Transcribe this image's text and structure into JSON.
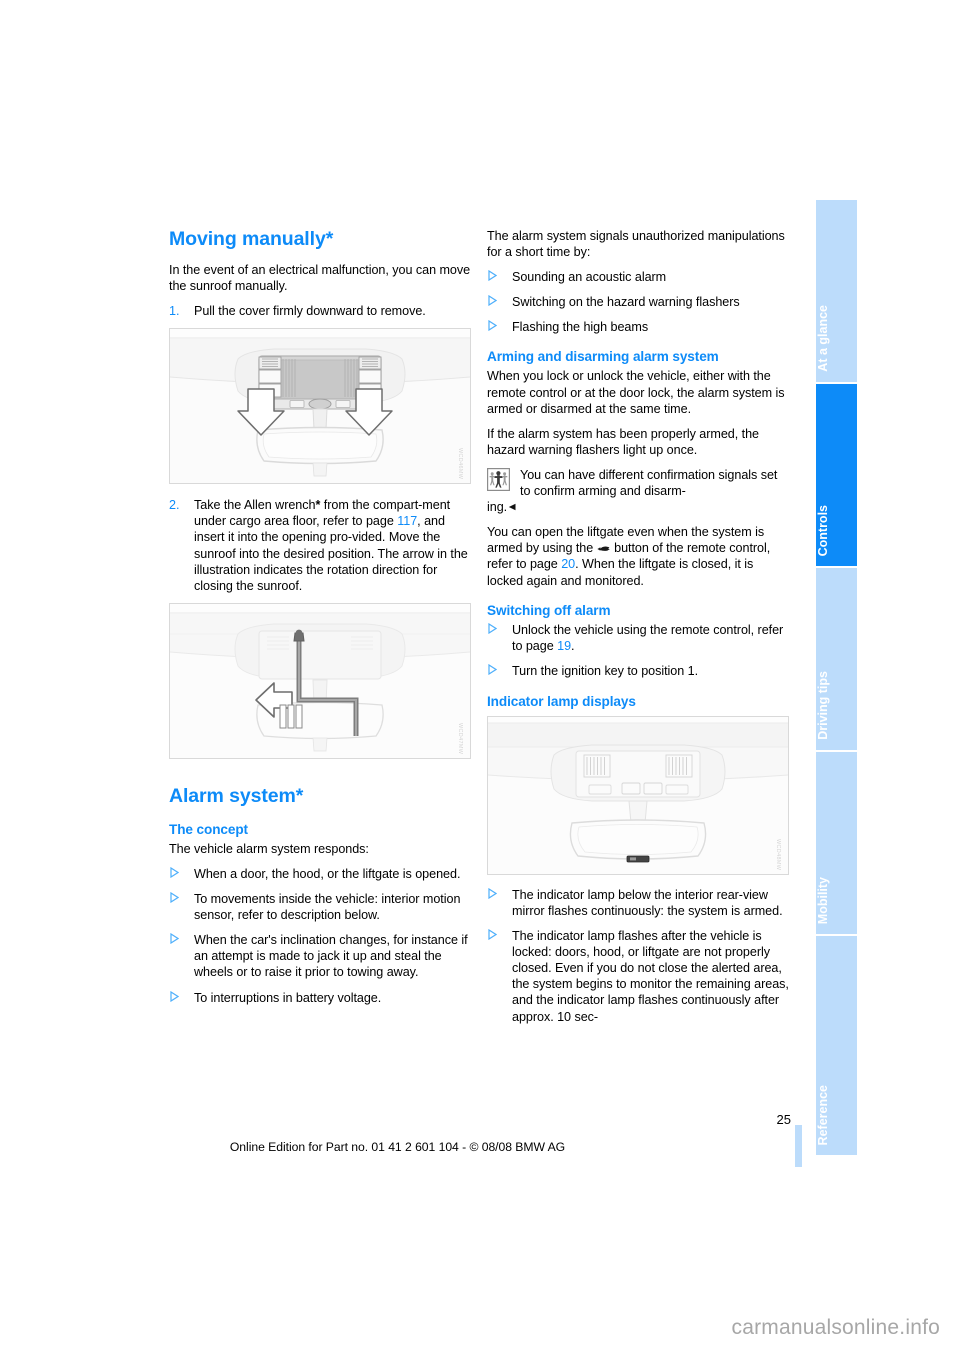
{
  "document": {
    "page_number": "25",
    "edition_line": "Online Edition for Part no. 01 41 2 601 104 - © 08/08 BMW AG",
    "site_watermark": "carmanualsonline.info"
  },
  "colors": {
    "accent_blue": "#0d8bf8",
    "tab_inactive": "#bcdcfb",
    "bullet_blue": "#4eaffb"
  },
  "tab_rail": {
    "tabs": [
      {
        "label": "At a glance",
        "active": false
      },
      {
        "label": "Controls",
        "active": true
      },
      {
        "label": "Driving tips",
        "active": false
      },
      {
        "label": "Mobility",
        "active": false
      },
      {
        "label": "Reference",
        "active": false
      }
    ]
  },
  "left_column": {
    "heading_moving_manually": "Moving manually*",
    "intro": "In the event of an electrical malfunction, you can move the sunroof manually.",
    "step1_num": "1.",
    "step1_text": "Pull the cover firmly downward to remove.",
    "figure1": {
      "code": "WCD46MW"
    },
    "step2_num": "2.",
    "step2_part1": "Take the Allen wrench",
    "step2_star": "*",
    "step2_part2": " from the compart-ment under cargo area floor, refer to page ",
    "step2_pageref": "117",
    "step2_part3": ", and insert it into the opening pro-vided. Move the sunroof into the desired position. The arrow in the illustration indicates the rotation direction for closing the sunroof.",
    "figure2": {
      "code": "WCD47MW"
    },
    "heading_alarm_system": "Alarm system*",
    "heading_concept": "The concept",
    "concept_intro": "The vehicle alarm system responds:",
    "concept_bullets": [
      "When a door, the hood, or the liftgate is opened.",
      "To movements inside the vehicle: interior motion sensor, refer to description below.",
      "When the car's inclination changes, for instance if an attempt is made to jack it up and steal the wheels or to raise it prior to towing away.",
      "To interruptions in battery voltage."
    ]
  },
  "right_column": {
    "signals_intro": "The alarm system signals unauthorized manipulations for a short time by:",
    "signal_bullets": [
      "Sounding an acoustic alarm",
      "Switching on the hazard warning flashers",
      "Flashing the high beams"
    ],
    "heading_arming": "Arming and disarming alarm system",
    "arming_p1": "When you lock or unlock the vehicle, either with the remote control or at the door lock, the alarm system is armed or disarmed at the same time.",
    "arming_p2": "If the alarm system has been properly armed, the hazard warning flashers light up once.",
    "note_text": "You can have different confirmation signals set to confirm arming and disarm-",
    "note_continuation": "ing.",
    "liftgate_part1": "You can open the liftgate even when the system is armed by using the ",
    "liftgate_part2": " button of the remote control, refer to page ",
    "liftgate_pageref": "20",
    "liftgate_part3": ". When the liftgate is closed, it is locked again and monitored.",
    "heading_switching_off": "Switching off alarm",
    "switching_bullets": [
      {
        "text_before": "Unlock the vehicle using the remote control, refer to page ",
        "pageref": "19",
        "text_after": "."
      },
      {
        "text_before": "Turn the ignition key to position 1.",
        "pageref": "",
        "text_after": ""
      }
    ],
    "heading_indicator": "Indicator lamp displays",
    "figure3": {
      "code": "WCD48MW"
    },
    "indicator_bullets": [
      "The indicator lamp below the interior rear-view mirror flashes continuously: the system is armed.",
      "The indicator lamp flashes after the vehicle is locked: doors, hood, or liftgate are not properly closed. Even if you do not close the alerted area, the system begins to monitor the remaining areas, and the indicator lamp flashes continuously after approx. 10 sec-"
    ]
  },
  "icons": {
    "pictogram": "interior-motion-sensor-pictogram",
    "liftgate_button": "liftgate-open-symbol",
    "end_mark": "note-end-triangle"
  }
}
